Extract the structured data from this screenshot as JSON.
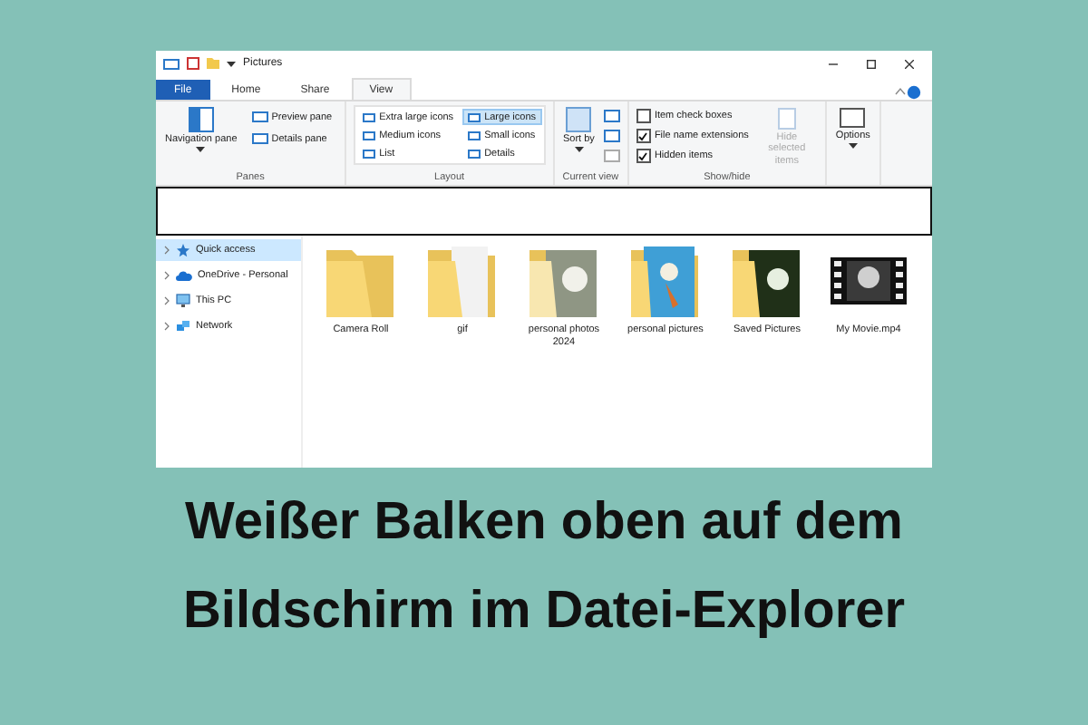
{
  "window": {
    "title": "Pictures"
  },
  "tabs": [
    {
      "label": "File",
      "selected": false,
      "kind": "file"
    },
    {
      "label": "Home",
      "selected": false,
      "kind": "tab"
    },
    {
      "label": "Share",
      "selected": false,
      "kind": "tab"
    },
    {
      "label": "View",
      "selected": true,
      "kind": "tab"
    }
  ],
  "ribbon": {
    "panes": {
      "title": "Panes",
      "navigation": "Navigation pane",
      "items": [
        "Preview pane",
        "Details pane"
      ]
    },
    "layout": {
      "title": "Layout",
      "items": [
        {
          "label": "Extra large icons",
          "selected": false
        },
        {
          "label": "Large icons",
          "selected": true
        },
        {
          "label": "Medium icons",
          "selected": false
        },
        {
          "label": "Small icons",
          "selected": false
        },
        {
          "label": "List",
          "selected": false
        },
        {
          "label": "Details",
          "selected": false
        }
      ]
    },
    "current_view": {
      "title": "Current view",
      "sort": "Sort by"
    },
    "show_hide": {
      "title": "Show/hide",
      "checkboxes": [
        {
          "label": "Item check boxes",
          "checked": false
        },
        {
          "label": "File name extensions",
          "checked": true
        },
        {
          "label": "Hidden items",
          "checked": true
        }
      ],
      "hide_selected": {
        "label": "Hide selected items",
        "disabled": true
      }
    },
    "options": "Options"
  },
  "nav": [
    {
      "label": "Quick access",
      "selected": true,
      "kind": "star"
    },
    {
      "label": "OneDrive - Personal",
      "selected": false,
      "kind": "cloud"
    },
    {
      "label": "This PC",
      "selected": false,
      "kind": "pc"
    },
    {
      "label": "Network",
      "selected": false,
      "kind": "network"
    }
  ],
  "files": [
    {
      "name": "Camera Roll",
      "kind": "folder"
    },
    {
      "name": "gif",
      "kind": "folder-doc"
    },
    {
      "name": "personal photos 2024",
      "kind": "folder-photo"
    },
    {
      "name": "personal pictures",
      "kind": "folder-blue"
    },
    {
      "name": "Saved Pictures",
      "kind": "folder-dark"
    },
    {
      "name": "My Movie.mp4",
      "kind": "video"
    }
  ],
  "caption": [
    "Weißer Balken oben auf dem",
    "Bildschirm im Datei-Explorer"
  ]
}
